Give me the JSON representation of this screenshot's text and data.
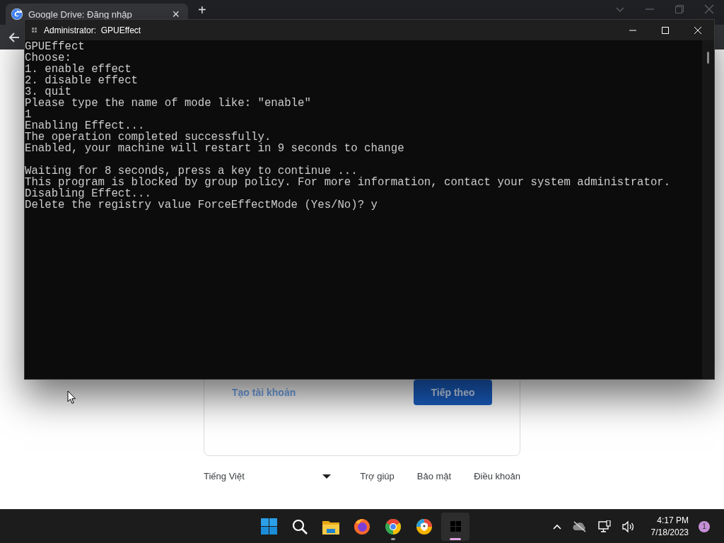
{
  "browser": {
    "tab": {
      "title": "Google Drive: Đăng nhập",
      "close": "×"
    },
    "new_tab": "+",
    "page": {
      "create_account_link": "Tạo tài khoản",
      "next_button": "Tiếp theo",
      "language": "Tiếng Việt",
      "footer_links": [
        "Trợ giúp",
        "Bảo mật",
        "Điều khoản"
      ]
    }
  },
  "console": {
    "title": "Administrator:  GPUEffect",
    "blocks": [
      {
        "lines": [
          "GPUEffect",
          "Choose:",
          "1. enable effect",
          "2. disable effect",
          "3. quit",
          "Please type the name of mode like: \"enable\"",
          "1",
          "Enabling Effect...",
          "The operation completed successfully.",
          "Enabled, your machine will restart in 9 seconds to change"
        ]
      },
      {
        "lines": [
          "Waiting for 8 seconds, press a key to continue ...",
          "This program is blocked by group policy. For more information, contact your system administrator.",
          "Disabling Effect...",
          "Delete the registry value ForceEffectMode (Yes/No)? y"
        ]
      }
    ]
  },
  "taskbar": {
    "apps": [
      {
        "kind": "start",
        "selected": false,
        "running": false
      },
      {
        "kind": "search",
        "selected": false,
        "running": false
      },
      {
        "kind": "files",
        "selected": false,
        "running": false
      },
      {
        "kind": "firefox",
        "selected": false,
        "running": false
      },
      {
        "kind": "chrome",
        "selected": false,
        "running": true
      },
      {
        "kind": "shield",
        "selected": false,
        "running": false
      },
      {
        "kind": "terminal",
        "selected": true,
        "running": true
      }
    ],
    "clock": {
      "time": "4:17 PM",
      "date": "7/18/2023"
    },
    "notification_count": "1"
  }
}
